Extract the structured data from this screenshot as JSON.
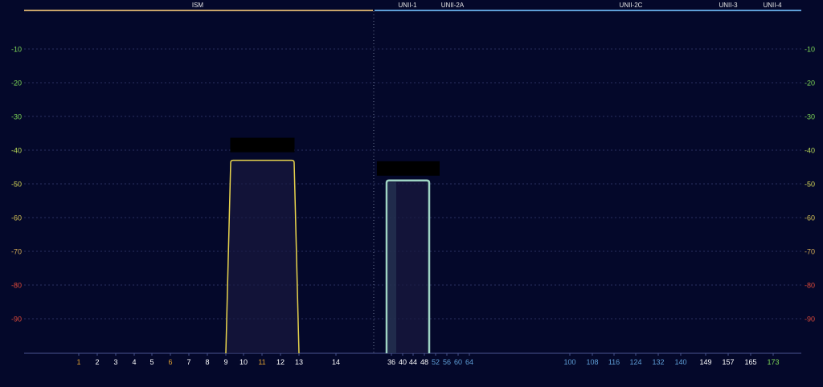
{
  "chart_data": {
    "type": "area",
    "title": "",
    "xlabel": "",
    "ylabel": "",
    "ylim": [
      -100,
      0
    ],
    "grid": true,
    "y_ticks": [
      -10,
      -20,
      -30,
      -40,
      -50,
      -60,
      -70,
      -80,
      -90
    ],
    "y_tick_colors": {
      "-10": "#7ed957",
      "-20": "#7ed957",
      "-30": "#7ed957",
      "-40": "#b8d957",
      "-50": "#d9d957",
      "-60": "#d9c557",
      "-70": "#d9b057",
      "-80": "#e04a3a",
      "-90": "#e04a3a"
    },
    "bands": [
      {
        "name": "ISM",
        "color": "#c9a46a",
        "x_start_channel_24": 1,
        "x_end_channel_24": 14
      },
      {
        "name": "UNII-1",
        "color": "#5f9fd8"
      },
      {
        "name": "UNII-2A",
        "color": "#5f9fd8"
      },
      {
        "name": "UNII-2C",
        "color": "#5f9fd8"
      },
      {
        "name": "UNII-3",
        "color": "#5f9fd8"
      },
      {
        "name": "UNII-4",
        "color": "#5f9fd8"
      }
    ],
    "x_channels_24": [
      {
        "label": "1",
        "color": "#e0a030"
      },
      {
        "label": "2",
        "color": "#ffffff"
      },
      {
        "label": "3",
        "color": "#ffffff"
      },
      {
        "label": "4",
        "color": "#ffffff"
      },
      {
        "label": "5",
        "color": "#ffffff"
      },
      {
        "label": "6",
        "color": "#e0a030"
      },
      {
        "label": "7",
        "color": "#ffffff"
      },
      {
        "label": "8",
        "color": "#ffffff"
      },
      {
        "label": "9",
        "color": "#ffffff"
      },
      {
        "label": "10",
        "color": "#ffffff"
      },
      {
        "label": "11",
        "color": "#e0a030"
      },
      {
        "label": "12",
        "color": "#ffffff"
      },
      {
        "label": "13",
        "color": "#ffffff"
      },
      {
        "label": "14",
        "color": "#ffffff"
      }
    ],
    "x_channels_5": [
      {
        "label": "36",
        "color": "#ffffff"
      },
      {
        "label": "40",
        "color": "#ffffff"
      },
      {
        "label": "44",
        "color": "#ffffff"
      },
      {
        "label": "48",
        "color": "#ffffff"
      },
      {
        "label": "52",
        "color": "#5f9fd8"
      },
      {
        "label": "56",
        "color": "#5f9fd8"
      },
      {
        "label": "60",
        "color": "#5f9fd8"
      },
      {
        "label": "64",
        "color": "#5f9fd8"
      },
      {
        "label": "100",
        "color": "#5f9fd8"
      },
      {
        "label": "108",
        "color": "#5f9fd8"
      },
      {
        "label": "116",
        "color": "#5f9fd8"
      },
      {
        "label": "124",
        "color": "#5f9fd8"
      },
      {
        "label": "132",
        "color": "#5f9fd8"
      },
      {
        "label": "140",
        "color": "#5f9fd8"
      },
      {
        "label": "149",
        "color": "#ffffff"
      },
      {
        "label": "157",
        "color": "#ffffff"
      },
      {
        "label": "165",
        "color": "#ffffff"
      },
      {
        "label": "173",
        "color": "#7ed957"
      }
    ],
    "series": [
      {
        "band": "2.4GHz",
        "color": "#e8d44d",
        "channel_start": 9,
        "channel_end": 13,
        "peak_dbm": -43,
        "label": ""
      },
      {
        "band": "5GHz",
        "color": "#9fd4c4",
        "channel_start": 36,
        "channel_end": 48,
        "peak_dbm": -49,
        "label": ""
      }
    ],
    "colors": {
      "background": "#04082a",
      "grid": "#2a3160",
      "axis": "#4a5590",
      "divider": "#6a7390"
    }
  }
}
